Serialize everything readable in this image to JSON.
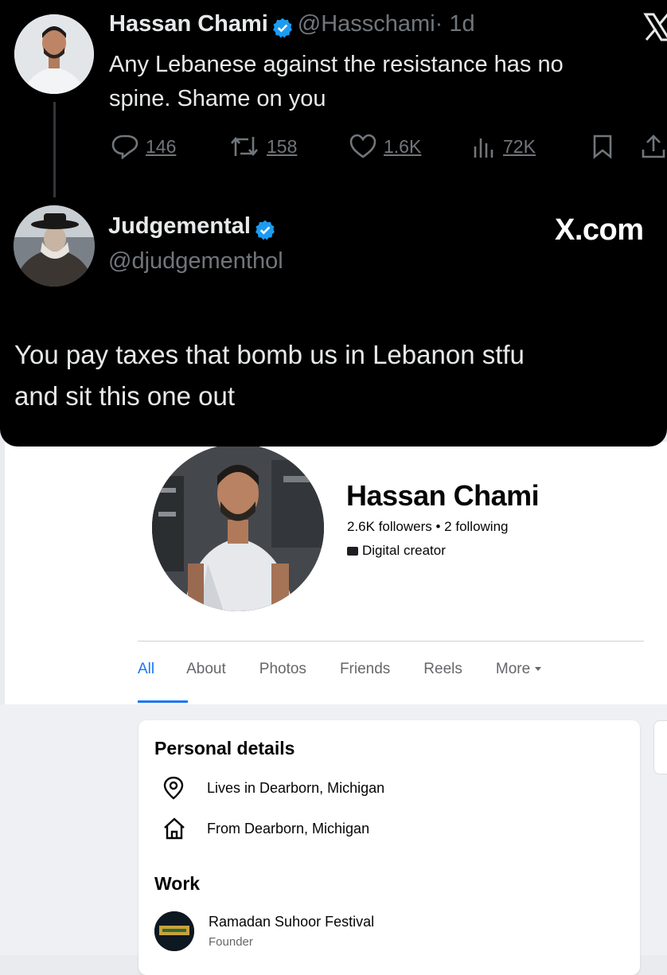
{
  "tweet": {
    "name": "Hassan Chami",
    "handle": "@Hasschami",
    "time": "· 1d",
    "text_line1": "Any Lebanese against the resistance has no",
    "text_line2": "spine. Shame on you",
    "actions": {
      "replies": "146",
      "reposts": "158",
      "likes": "1.6K",
      "views": "72K"
    }
  },
  "reply": {
    "name": "Judgemental",
    "handle": "@djudgementhol",
    "text_line1": "You pay taxes that bomb us in Lebanon stfu",
    "text_line2": "and sit this one out"
  },
  "watermark": "X.com",
  "profile": {
    "name": "Hassan Chami",
    "followers": "2.6K followers • 2 following",
    "category": "Digital creator",
    "tabs": [
      "All",
      "About",
      "Photos",
      "Friends",
      "Reels",
      "More"
    ],
    "active_tab": "All",
    "personal_details_title": "Personal details",
    "lives_in": "Lives in Dearborn, Michigan",
    "from": "From Dearborn, Michigan",
    "work_title": "Work",
    "work_place": "Ramadan Suhoor Festival",
    "work_role": "Founder"
  },
  "colors": {
    "x_background": "#000000",
    "verified_badge": "#1d9bf0",
    "fb_accent": "#1877f2"
  }
}
